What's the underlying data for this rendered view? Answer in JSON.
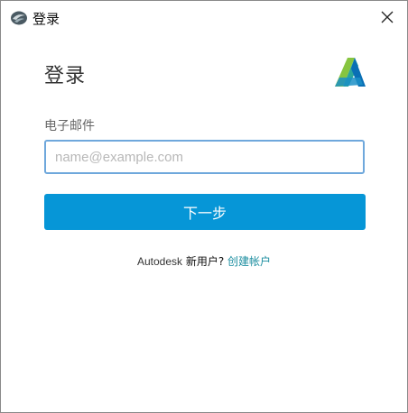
{
  "window": {
    "title": "登录",
    "app_icon": "autodesk-swirl-icon",
    "close_icon": "close-icon"
  },
  "main": {
    "heading": "登录",
    "logo": "autodesk-logo-icon",
    "email_label": "电子邮件",
    "email_value": "",
    "email_placeholder": "name@example.com",
    "next_button": "下一步"
  },
  "signup": {
    "brand": "Autodesk",
    "question": "新用户?",
    "link": "创建帐户"
  },
  "colors": {
    "primary": "#0696d7",
    "link": "#1c8ea0",
    "input_border": "#6fa8dc"
  }
}
